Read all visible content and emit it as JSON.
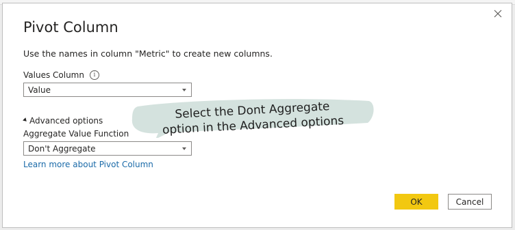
{
  "dialog": {
    "title": "Pivot Column",
    "description": "Use the names in column \"Metric\" to create new columns.",
    "close_icon": "close-icon"
  },
  "values_column": {
    "label": "Values Column",
    "info_icon": "info-icon",
    "selected": "Value"
  },
  "advanced": {
    "toggle_label": "Advanced options",
    "aggregate_label": "Aggregate Value Function",
    "aggregate_selected": "Don't Aggregate"
  },
  "learn_more_link": "Learn more about Pivot Column",
  "callout": {
    "line1": "Select the Dont Aggregate",
    "line2": "option in the Advanced options",
    "fill_color": "#d4e2de"
  },
  "buttons": {
    "ok": "OK",
    "cancel": "Cancel",
    "ok_color": "#f2c811"
  }
}
